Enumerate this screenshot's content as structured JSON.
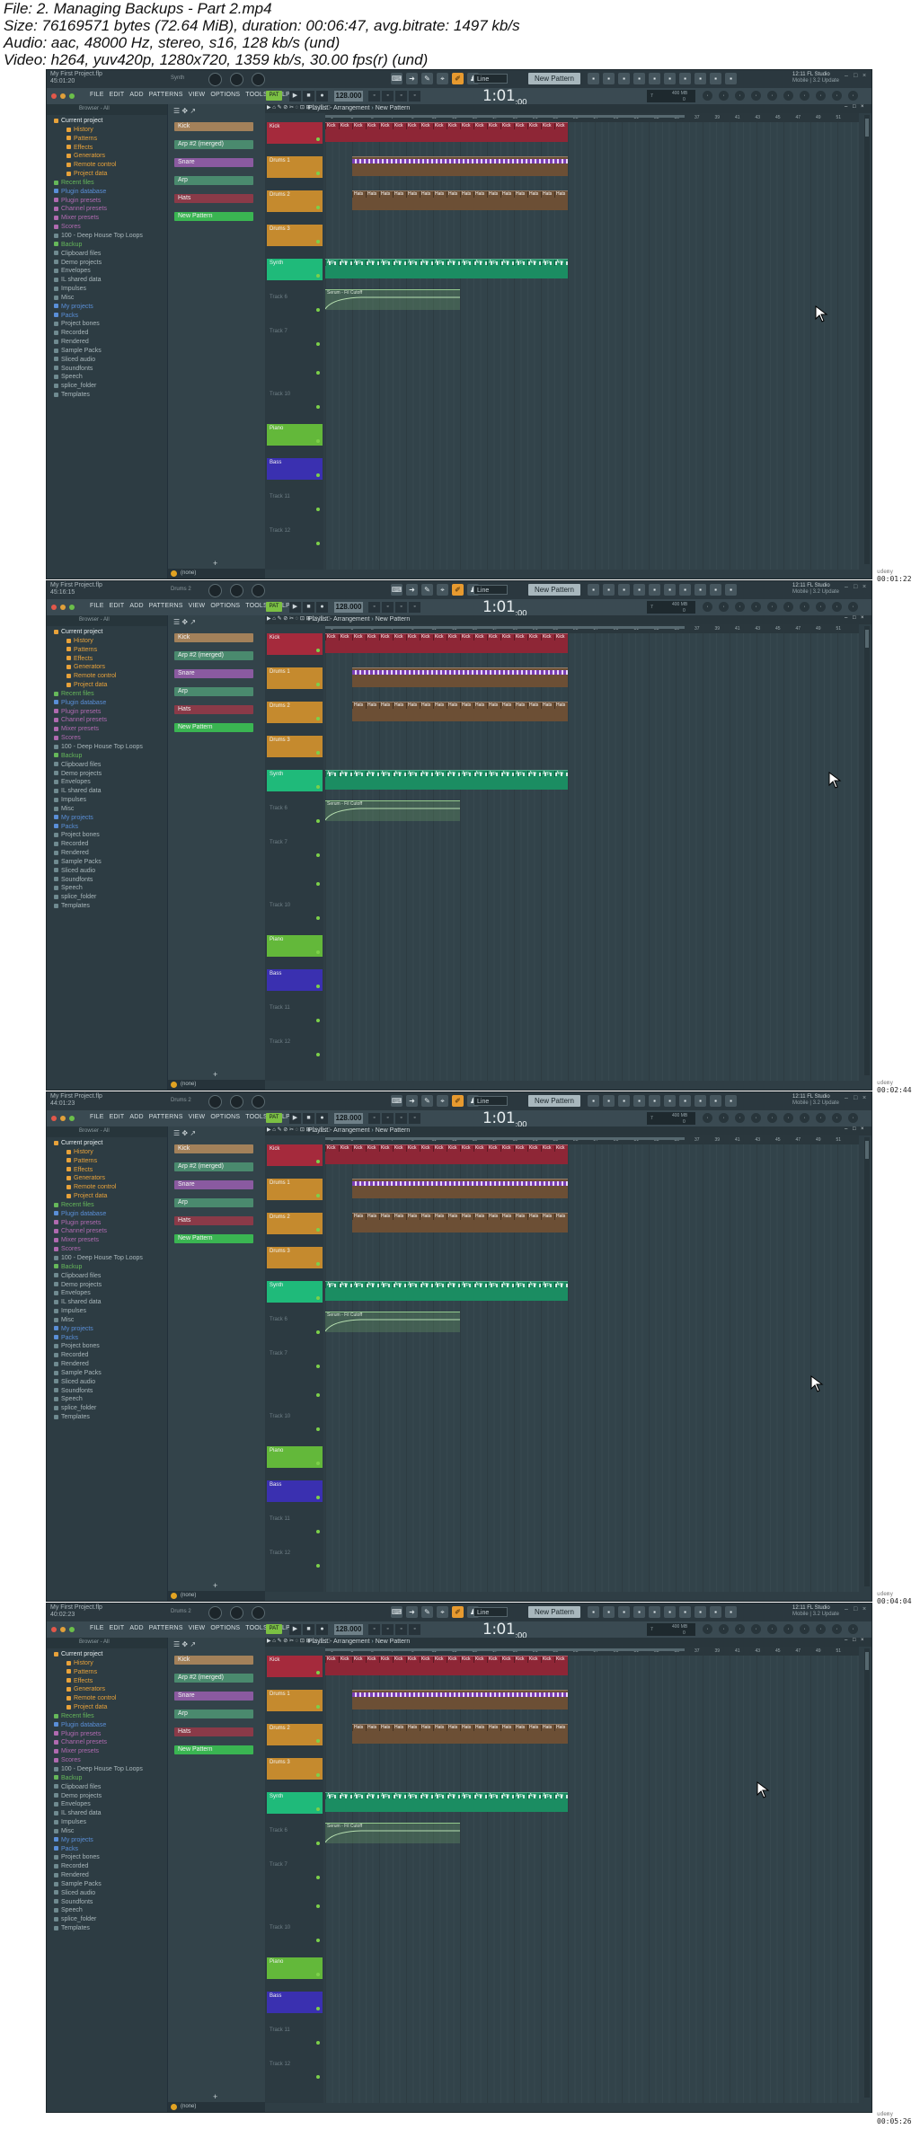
{
  "file_info": [
    "File: 2. Managing Backups - Part 2.mp4",
    "Size: 76169571 bytes (72.64 MiB), duration: 00:06:47, avg.bitrate: 1497 kb/s",
    "Audio: aac, 48000 Hz, stereo, s16, 128 kb/s (und)",
    "Video: h264, yuv420p, 1280x720, 1359 kb/s, 30.00 fps(r) (und)"
  ],
  "timestamp_site": "udemy",
  "frames": [
    {
      "project_name": "My First Project.flp",
      "project_pos": "45:01:20",
      "hint": "Synth",
      "timestamp": "00:01:22"
    },
    {
      "project_name": "My First Project.flp",
      "project_pos": "45:16:15",
      "hint": "Drums 2",
      "timestamp": "00:02:44"
    },
    {
      "project_name": "My First Project.flp",
      "project_pos": "44:01:23",
      "hint": "Drums 2",
      "timestamp": "00:04:04"
    },
    {
      "project_name": "My First Project.flp",
      "project_pos": "40:02:23",
      "hint": "Drums 2",
      "timestamp": "00:05:26"
    }
  ],
  "menu": [
    "FILE",
    "EDIT",
    "ADD",
    "PATTERNS",
    "VIEW",
    "OPTIONS",
    "TOOLS",
    "HELP"
  ],
  "pat_button": "PAT",
  "tempo": "128.000",
  "time_main": "1:01",
  "time_sub": ":00",
  "snap": "Line",
  "pattern_selector": "New Pattern",
  "fl_news": [
    "12:11  FL Studio",
    "Mobile | 3.2 Update"
  ],
  "monitor": {
    "mem": "400 MB",
    "cpu": "0",
    "poly": "7"
  },
  "browser": {
    "header": "Browser - All",
    "items": [
      {
        "label": "Current project",
        "level": 1,
        "color": "#e8a23a"
      },
      {
        "label": "History",
        "level": 2,
        "color": "#e8a23a"
      },
      {
        "label": "Patterns",
        "level": 2,
        "color": "#e8a23a"
      },
      {
        "label": "Effects",
        "level": 2,
        "color": "#e8a23a"
      },
      {
        "label": "Generators",
        "level": 2,
        "color": "#e8a23a"
      },
      {
        "label": "Remote control",
        "level": 2,
        "color": "#e8a23a"
      },
      {
        "label": "Project data",
        "level": 2,
        "color": "#e8a23a"
      },
      {
        "label": "Recent files",
        "level": 1,
        "color": "#66b85a"
      },
      {
        "label": "Plugin database",
        "level": 1,
        "color": "#5a8fd8"
      },
      {
        "label": "Plugin presets",
        "level": 1,
        "color": "#b06ab0"
      },
      {
        "label": "Channel presets",
        "level": 1,
        "color": "#b06ab0"
      },
      {
        "label": "Mixer presets",
        "level": 1,
        "color": "#b06ab0"
      },
      {
        "label": "Scores",
        "level": 1,
        "color": "#b06ab0"
      },
      {
        "label": "100 - Deep House Top Loops",
        "level": 1,
        "color": "#6f8a90"
      },
      {
        "label": "Backup",
        "level": 1,
        "color": "#66b85a"
      },
      {
        "label": "Clipboard files",
        "level": 1,
        "color": "#6f8a90"
      },
      {
        "label": "Demo projects",
        "level": 1,
        "color": "#6f8a90"
      },
      {
        "label": "Envelopes",
        "level": 1,
        "color": "#6f8a90"
      },
      {
        "label": "IL shared data",
        "level": 1,
        "color": "#6f8a90"
      },
      {
        "label": "Impulses",
        "level": 1,
        "color": "#6f8a90"
      },
      {
        "label": "Misc",
        "level": 1,
        "color": "#6f8a90"
      },
      {
        "label": "My projects",
        "level": 1,
        "color": "#5a8fd8"
      },
      {
        "label": "Packs",
        "level": 1,
        "color": "#5a8fd8"
      },
      {
        "label": "Project bones",
        "level": 1,
        "color": "#6f8a90"
      },
      {
        "label": "Recorded",
        "level": 1,
        "color": "#6f8a90"
      },
      {
        "label": "Rendered",
        "level": 1,
        "color": "#6f8a90"
      },
      {
        "label": "Sample Packs",
        "level": 1,
        "color": "#6f8a90"
      },
      {
        "label": "Sliced audio",
        "level": 1,
        "color": "#6f8a90"
      },
      {
        "label": "Soundfonts",
        "level": 1,
        "color": "#6f8a90"
      },
      {
        "label": "Speech",
        "level": 1,
        "color": "#6f8a90"
      },
      {
        "label": "splice_folder",
        "level": 1,
        "color": "#6f8a90"
      },
      {
        "label": "Templates",
        "level": 1,
        "color": "#6f8a90"
      }
    ]
  },
  "picker": [
    {
      "label": "Kick",
      "color": "#a3815a"
    },
    {
      "label": "Arp #2 (merged)",
      "color": "#4a8a6e"
    },
    {
      "label": "Snare",
      "color": "#8a5aa0"
    },
    {
      "label": "Arp",
      "color": "#4a8a6e"
    },
    {
      "label": "Hats",
      "color": "#8a3a48"
    },
    {
      "label": "New Pattern",
      "color": "#3ab552"
    }
  ],
  "status_label": "(none)",
  "playlist_title": "Playlist - Arrangement",
  "playlist_pattern": "New Pattern",
  "tracks": [
    {
      "label": "Kick",
      "color": "#a52a3c",
      "h": 26
    },
    {
      "label": "Drums 1",
      "color": "#c58a2e",
      "h": 26
    },
    {
      "label": "Drums 2",
      "color": "#c58a2e",
      "h": 26
    },
    {
      "label": "Drums 3",
      "color": "#c58a2e",
      "h": 26
    },
    {
      "label": "Synth",
      "color": "#1fba7a",
      "h": 26
    },
    {
      "label": "Track 6",
      "color": "",
      "h": 26
    },
    {
      "label": "Track 7",
      "color": "",
      "h": 26
    },
    {
      "label": "",
      "color": "",
      "h": 20
    },
    {
      "label": "Track 10",
      "color": "",
      "h": 26
    },
    {
      "label": "Piano",
      "color": "#63b83a",
      "h": 26
    },
    {
      "label": "Bass",
      "color": "#3a30b0",
      "h": 26
    },
    {
      "label": "Track 11",
      "color": "",
      "h": 26
    },
    {
      "label": "Track 12",
      "color": "",
      "h": 26
    }
  ],
  "clips": {
    "kick": "Kick",
    "hats": "Hats",
    "arp": "Arp",
    "automation": "Serum - Fil Cutoff"
  },
  "ruler_numbers": [
    "1",
    "3",
    "5",
    "7",
    "9",
    "11",
    "13",
    "15",
    "17",
    "19",
    "21",
    "23",
    "25",
    "27",
    "29",
    "31",
    "33",
    "35",
    "37",
    "39",
    "41",
    "43",
    "45",
    "47",
    "49",
    "51"
  ]
}
